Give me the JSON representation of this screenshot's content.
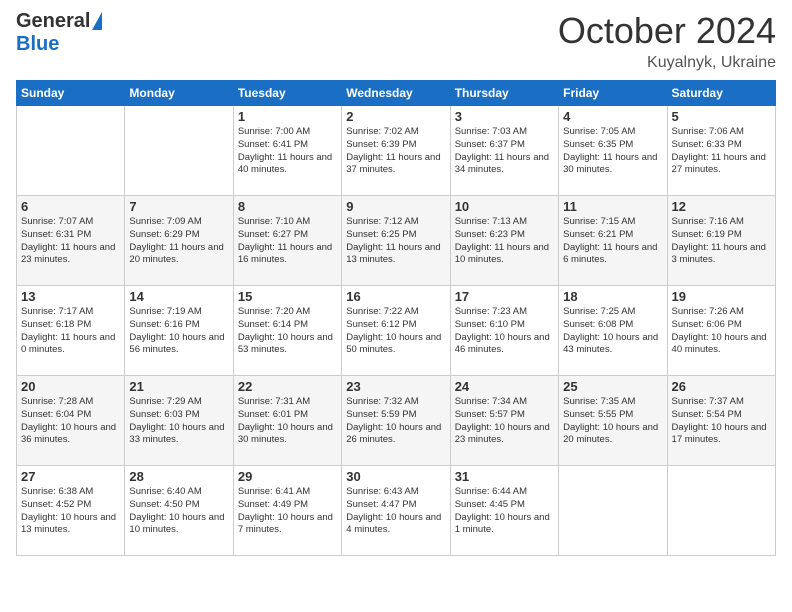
{
  "logo": {
    "general": "General",
    "blue": "Blue"
  },
  "title": "October 2024",
  "location": "Kuyalnyk, Ukraine",
  "days_of_week": [
    "Sunday",
    "Monday",
    "Tuesday",
    "Wednesday",
    "Thursday",
    "Friday",
    "Saturday"
  ],
  "weeks": [
    [
      {
        "day": "",
        "info": ""
      },
      {
        "day": "",
        "info": ""
      },
      {
        "day": "1",
        "info": "Sunrise: 7:00 AM\nSunset: 6:41 PM\nDaylight: 11 hours and 40 minutes."
      },
      {
        "day": "2",
        "info": "Sunrise: 7:02 AM\nSunset: 6:39 PM\nDaylight: 11 hours and 37 minutes."
      },
      {
        "day": "3",
        "info": "Sunrise: 7:03 AM\nSunset: 6:37 PM\nDaylight: 11 hours and 34 minutes."
      },
      {
        "day": "4",
        "info": "Sunrise: 7:05 AM\nSunset: 6:35 PM\nDaylight: 11 hours and 30 minutes."
      },
      {
        "day": "5",
        "info": "Sunrise: 7:06 AM\nSunset: 6:33 PM\nDaylight: 11 hours and 27 minutes."
      }
    ],
    [
      {
        "day": "6",
        "info": "Sunrise: 7:07 AM\nSunset: 6:31 PM\nDaylight: 11 hours and 23 minutes."
      },
      {
        "day": "7",
        "info": "Sunrise: 7:09 AM\nSunset: 6:29 PM\nDaylight: 11 hours and 20 minutes."
      },
      {
        "day": "8",
        "info": "Sunrise: 7:10 AM\nSunset: 6:27 PM\nDaylight: 11 hours and 16 minutes."
      },
      {
        "day": "9",
        "info": "Sunrise: 7:12 AM\nSunset: 6:25 PM\nDaylight: 11 hours and 13 minutes."
      },
      {
        "day": "10",
        "info": "Sunrise: 7:13 AM\nSunset: 6:23 PM\nDaylight: 11 hours and 10 minutes."
      },
      {
        "day": "11",
        "info": "Sunrise: 7:15 AM\nSunset: 6:21 PM\nDaylight: 11 hours and 6 minutes."
      },
      {
        "day": "12",
        "info": "Sunrise: 7:16 AM\nSunset: 6:19 PM\nDaylight: 11 hours and 3 minutes."
      }
    ],
    [
      {
        "day": "13",
        "info": "Sunrise: 7:17 AM\nSunset: 6:18 PM\nDaylight: 11 hours and 0 minutes."
      },
      {
        "day": "14",
        "info": "Sunrise: 7:19 AM\nSunset: 6:16 PM\nDaylight: 10 hours and 56 minutes."
      },
      {
        "day": "15",
        "info": "Sunrise: 7:20 AM\nSunset: 6:14 PM\nDaylight: 10 hours and 53 minutes."
      },
      {
        "day": "16",
        "info": "Sunrise: 7:22 AM\nSunset: 6:12 PM\nDaylight: 10 hours and 50 minutes."
      },
      {
        "day": "17",
        "info": "Sunrise: 7:23 AM\nSunset: 6:10 PM\nDaylight: 10 hours and 46 minutes."
      },
      {
        "day": "18",
        "info": "Sunrise: 7:25 AM\nSunset: 6:08 PM\nDaylight: 10 hours and 43 minutes."
      },
      {
        "day": "19",
        "info": "Sunrise: 7:26 AM\nSunset: 6:06 PM\nDaylight: 10 hours and 40 minutes."
      }
    ],
    [
      {
        "day": "20",
        "info": "Sunrise: 7:28 AM\nSunset: 6:04 PM\nDaylight: 10 hours and 36 minutes."
      },
      {
        "day": "21",
        "info": "Sunrise: 7:29 AM\nSunset: 6:03 PM\nDaylight: 10 hours and 33 minutes."
      },
      {
        "day": "22",
        "info": "Sunrise: 7:31 AM\nSunset: 6:01 PM\nDaylight: 10 hours and 30 minutes."
      },
      {
        "day": "23",
        "info": "Sunrise: 7:32 AM\nSunset: 5:59 PM\nDaylight: 10 hours and 26 minutes."
      },
      {
        "day": "24",
        "info": "Sunrise: 7:34 AM\nSunset: 5:57 PM\nDaylight: 10 hours and 23 minutes."
      },
      {
        "day": "25",
        "info": "Sunrise: 7:35 AM\nSunset: 5:55 PM\nDaylight: 10 hours and 20 minutes."
      },
      {
        "day": "26",
        "info": "Sunrise: 7:37 AM\nSunset: 5:54 PM\nDaylight: 10 hours and 17 minutes."
      }
    ],
    [
      {
        "day": "27",
        "info": "Sunrise: 6:38 AM\nSunset: 4:52 PM\nDaylight: 10 hours and 13 minutes."
      },
      {
        "day": "28",
        "info": "Sunrise: 6:40 AM\nSunset: 4:50 PM\nDaylight: 10 hours and 10 minutes."
      },
      {
        "day": "29",
        "info": "Sunrise: 6:41 AM\nSunset: 4:49 PM\nDaylight: 10 hours and 7 minutes."
      },
      {
        "day": "30",
        "info": "Sunrise: 6:43 AM\nSunset: 4:47 PM\nDaylight: 10 hours and 4 minutes."
      },
      {
        "day": "31",
        "info": "Sunrise: 6:44 AM\nSunset: 4:45 PM\nDaylight: 10 hours and 1 minute."
      },
      {
        "day": "",
        "info": ""
      },
      {
        "day": "",
        "info": ""
      }
    ]
  ]
}
